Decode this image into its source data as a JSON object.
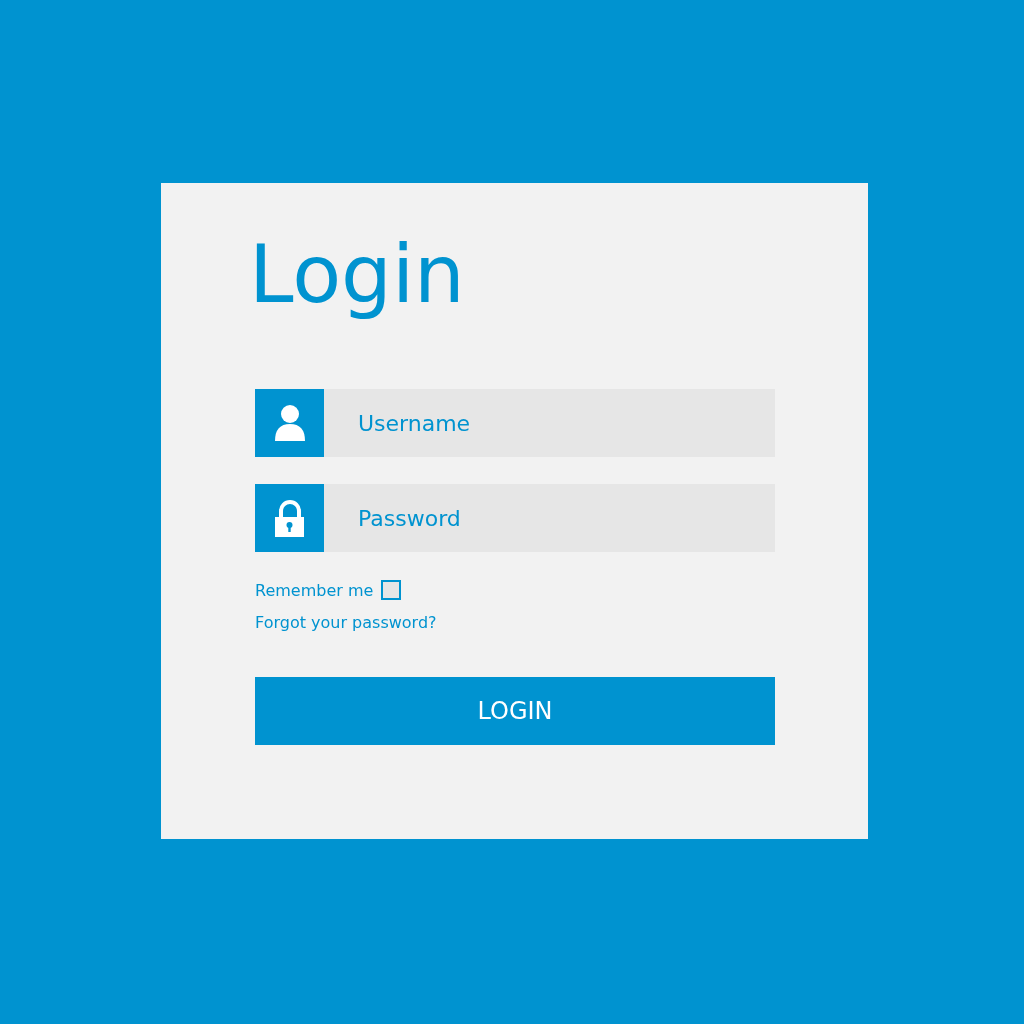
{
  "title": "Login",
  "fields": [
    {
      "kind": "username",
      "placeholder": "Username"
    },
    {
      "kind": "password",
      "placeholder": "Password"
    }
  ],
  "remember": {
    "label": "Remember me",
    "checked": false
  },
  "forgot_link": "Forgot your password?",
  "login_button": "LOGIN"
}
